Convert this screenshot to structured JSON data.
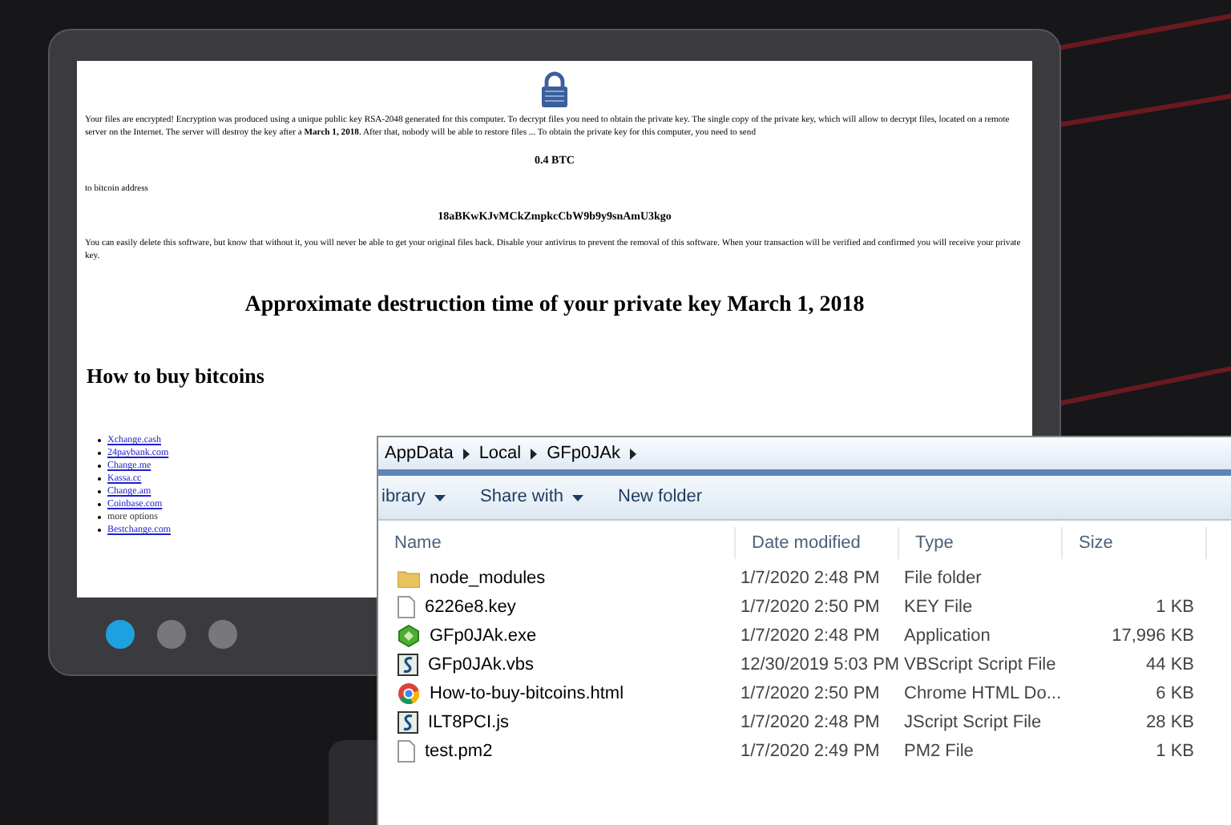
{
  "ransom_note": {
    "paragraph_1": "Your files are encrypted! Encryption was produced using a unique public key RSA-2048 generated for this computer. To decrypt files you need to obtain the private key. The single copy of the private key, which will allow to decrypt files, located on a remote server on the Internet. The server will destroy the key after a **March 1, 2018**. After that, nobody will be able to restore files ... To obtain the private key for this computer, you need to send",
    "amount": "0.4 BTC",
    "address_label": "to bitcoin address",
    "address": "18aBKwKJvMCkZmpkcCbW9b9y9snAmU3kgo",
    "paragraph_2": "You can easily delete this software, but know that without it, you will never be able to get your original files back. Disable your antivirus to prevent the removal of this software. When your transaction will be verified and confirmed you will receive your private key.",
    "deadline": "Approximate destruction time of your private key March 1, 2018",
    "heading": "How to buy bitcoins",
    "links": [
      {
        "text": "Xchange.cash",
        "kind": "link"
      },
      {
        "text": "24paybank.com",
        "kind": "link"
      },
      {
        "text": "Change.me",
        "kind": "link"
      },
      {
        "text": "Kassa.cc",
        "kind": "link"
      },
      {
        "text": "Change.am",
        "kind": "link"
      },
      {
        "text": "Coinbase.com",
        "kind": "link"
      },
      {
        "text": "more options",
        "kind": "plain"
      },
      {
        "text": "Bestchange.com",
        "kind": "link"
      }
    ]
  },
  "slide_dots": [
    {
      "selected": true
    },
    {
      "selected": false
    },
    {
      "selected": false
    }
  ],
  "explorer": {
    "breadcrumb": [
      "AppData",
      "Local",
      "GFp0JAk"
    ],
    "toolbar": [
      {
        "label": "ibrary",
        "dropdown": true
      },
      {
        "label": "Share with",
        "dropdown": true
      },
      {
        "label": "New folder",
        "dropdown": false
      }
    ],
    "columns": [
      "Name",
      "Date modified",
      "Type",
      "Size"
    ],
    "rows": [
      {
        "kind": "folder",
        "name": "node_modules",
        "date": "1/7/2020 2:48 PM",
        "type": "File folder",
        "size": ""
      },
      {
        "kind": "file",
        "name": "6226e8.key",
        "date": "1/7/2020 2:50 PM",
        "type": "KEY File",
        "size": "1 KB"
      },
      {
        "kind": "app",
        "name": "GFp0JAk.exe",
        "date": "1/7/2020 2:48 PM",
        "type": "Application",
        "size": "17,996 KB"
      },
      {
        "kind": "script",
        "name": "GFp0JAk.vbs",
        "date": "12/30/2019 5:03 PM",
        "type": "VBScript Script File",
        "size": "44 KB"
      },
      {
        "kind": "browser",
        "name": "How-to-buy-bitcoins.html",
        "date": "1/7/2020 2:50 PM",
        "type": "Chrome HTML Do...",
        "size": "6 KB"
      },
      {
        "kind": "script",
        "name": "ILT8PCI.js",
        "date": "1/7/2020 2:48 PM",
        "type": "JScript Script File",
        "size": "28 KB"
      },
      {
        "kind": "file",
        "name": "test.pm2",
        "date": "1/7/2020 2:49 PM",
        "type": "PM2 File",
        "size": "1 KB"
      }
    ]
  }
}
